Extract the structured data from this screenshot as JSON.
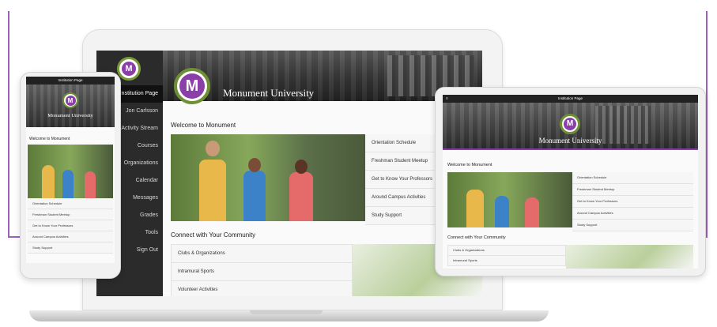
{
  "laptop": {
    "sidebar": [
      {
        "label": "Institution Page",
        "active": true
      },
      {
        "label": "Jon Carlsson",
        "active": false
      },
      {
        "label": "Activity Stream",
        "active": false
      },
      {
        "label": "Courses",
        "active": false
      },
      {
        "label": "Organizations",
        "active": false
      },
      {
        "label": "Calendar",
        "active": false
      },
      {
        "label": "Messages",
        "active": false
      },
      {
        "label": "Grades",
        "active": false
      },
      {
        "label": "Tools",
        "active": false
      },
      {
        "label": "Sign Out",
        "active": false
      }
    ],
    "banner_title": "Monument University",
    "logo_letter": "M",
    "welcome": "Welcome to Monument",
    "links": [
      "Orientation Schedule",
      "Freshman Student Meetup",
      "Get to Know Your Professors",
      "Around Campus Activities",
      "Study Support"
    ],
    "connect_heading": "Connect with Your Community",
    "community": [
      "Clubs & Organizations",
      "Intramural Sports",
      "Volunteer Activities"
    ]
  },
  "phone": {
    "topbar": "Institution Page",
    "banner_title": "Monument University",
    "logo_letter": "M",
    "welcome": "Welcome to Monument",
    "links": [
      "Orientation Schedule",
      "Freshman Student Meetup",
      "Get to Know Your Professors",
      "Around Campus Activities",
      "Study Support"
    ]
  },
  "tablet": {
    "topbar": "Institution Page",
    "menu_icon": "≡",
    "banner_title": "Monument University",
    "logo_letter": "M",
    "welcome": "Welcome to Monument",
    "links": [
      "Orientation Schedule",
      "Freshman Student Meetup",
      "Get to Know Your Professors",
      "Around Campus Activities",
      "Study Support"
    ],
    "connect_heading": "Connect with Your Community",
    "community": [
      "Clubs & Organizations",
      "Intramural Sports"
    ]
  },
  "colors": {
    "accent": "#8b3fa8",
    "emblem_ring": "#6f8f35",
    "sidebar": "#2b2b2b"
  }
}
